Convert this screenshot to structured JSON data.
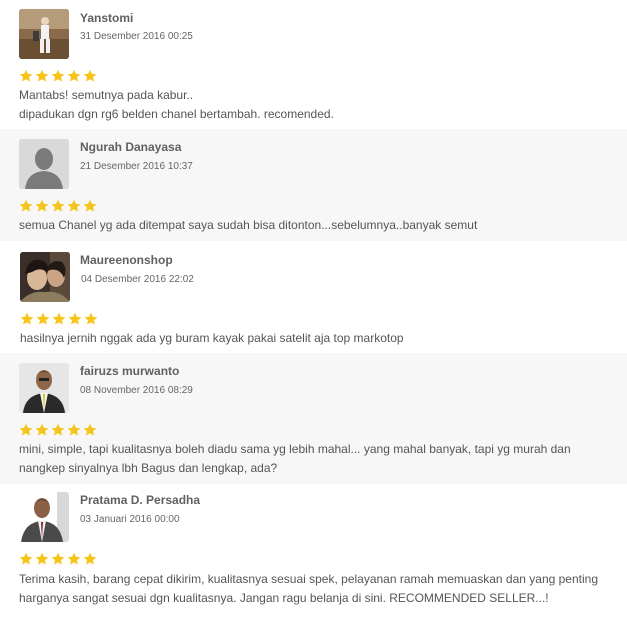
{
  "reviews": [
    {
      "name": "Yanstomi",
      "date": "31 Desember 2016 00:25",
      "rating": 5,
      "avatar": "photo-person-field",
      "lines": [
        "Mantabs! semutnya pada kabur..",
        "dipadukan dgn rg6 belden chanel bertambah. recomended."
      ]
    },
    {
      "name": "Ngurah Danayasa",
      "date": "21 Desember 2016 10:37",
      "rating": 5,
      "avatar": "default-user-icon",
      "lines": [
        "semua Chanel yg ada ditempat saya sudah bisa ditonton...sebelumnya..banyak semut"
      ]
    },
    {
      "name": "Maureenonshop",
      "date": "04 Desember 2016 22:02",
      "rating": 5,
      "avatar": "photo-couple",
      "lines": [
        "hasilnya jernih nggak ada yg buram kayak pakai satelit aja top markotop"
      ]
    },
    {
      "name": "fairuzs murwanto",
      "date": "08 November 2016 08:29",
      "rating": 5,
      "avatar": "photo-man-suit",
      "lines": [
        "mini, simple, tapi kualitasnya boleh diadu sama yg lebih mahal... yang mahal banyak, tapi yg murah dan",
        "nangkep sinyalnya lbh Bagus dan lengkap, ada?"
      ]
    },
    {
      "name": "Pratama D. Persadha",
      "date": "03 Januari 2016 00:00",
      "rating": 5,
      "avatar": "photo-man-suit-2",
      "lines": [
        "Terima kasih, barang cepat dikirim, kualitasnya sesuai spek, pelayanan ramah memuaskan dan yang penting",
        "harganya sangat sesuai dgn kualitasnya. Jangan ragu belanja di sini. RECOMMENDED SELLER...!"
      ]
    }
  ],
  "colors": {
    "star": "#f5c518",
    "alt_bg": "#f7f7f7"
  }
}
